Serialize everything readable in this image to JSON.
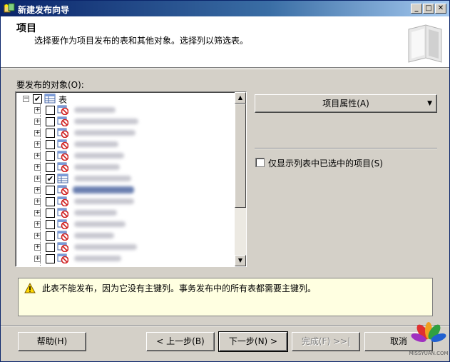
{
  "window": {
    "title": "新建发布向导"
  },
  "header": {
    "title": "项目",
    "description": "选择要作为项目发布的表和其他对象。选择列以筛选表。"
  },
  "objects": {
    "label": "要发布的对象(O):",
    "root": {
      "label": "表",
      "checked": "✔"
    },
    "rows": [
      {
        "checked": "",
        "selected": false
      },
      {
        "checked": "",
        "selected": false
      },
      {
        "checked": "",
        "selected": false
      },
      {
        "checked": "",
        "selected": false
      },
      {
        "checked": "",
        "selected": false
      },
      {
        "checked": "",
        "selected": false
      },
      {
        "checked": "✔",
        "selected": false
      },
      {
        "checked": "",
        "selected": true
      },
      {
        "checked": "",
        "selected": false
      },
      {
        "checked": "",
        "selected": false
      },
      {
        "checked": "",
        "selected": false
      },
      {
        "checked": "",
        "selected": false
      },
      {
        "checked": "",
        "selected": false
      },
      {
        "checked": "",
        "selected": false
      }
    ]
  },
  "properties_button": {
    "label": "项目属性(A)"
  },
  "show_selected": {
    "label": "仅显示列表中已选中的项目(S)"
  },
  "warning": {
    "text": "此表不能发布，因为它没有主键列。事务发布中的所有表都需要主键列。"
  },
  "buttons": {
    "help": "帮助(H)",
    "back": "< 上一步(B)",
    "next": "下一步(N) >",
    "finish": "完成(F) >>|",
    "cancel": "取消"
  },
  "watermark": "MISSYUAN.COM"
}
